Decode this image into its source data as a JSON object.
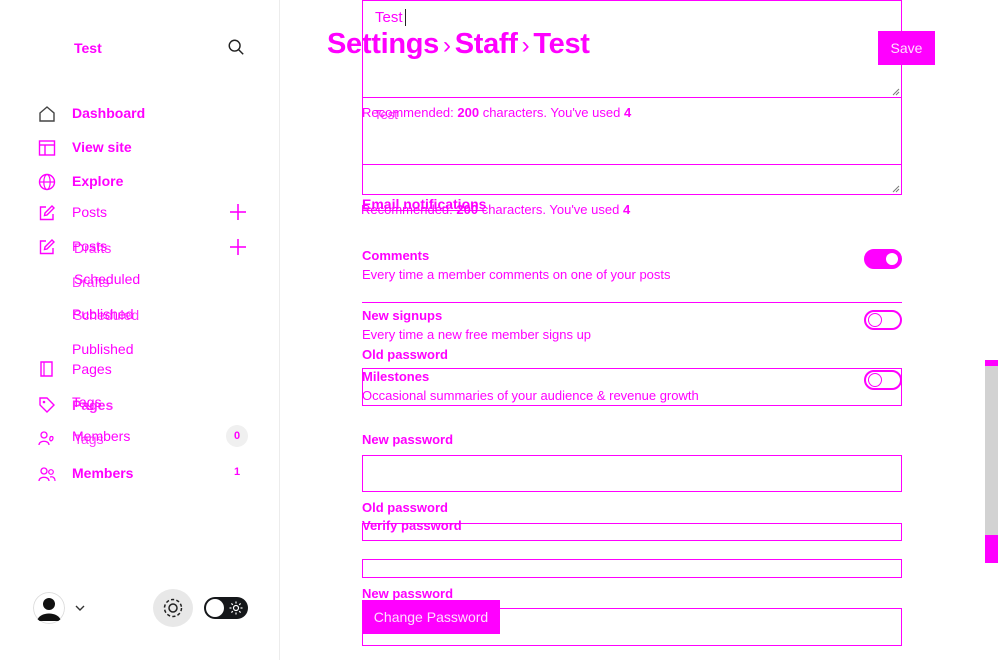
{
  "sidebar": {
    "site_name": "Test",
    "nav": {
      "dashboard": "Dashboard",
      "view_site": "View site",
      "explore": "Explore",
      "posts": "Posts",
      "drafts": "Drafts",
      "scheduled": "Scheduled",
      "published": "Published",
      "pages": "Pages",
      "tags": "Tags",
      "members": "Members"
    },
    "overlap": {
      "posts_shadow": "Posts",
      "drafts_shadow": "Drafts",
      "scheduled_shadow": "Scheduled",
      "published_shadow": "Published",
      "pages_shadow": "Pages",
      "members_shadow": "Members"
    },
    "counts": {
      "members_primary": "0",
      "members_secondary": "1"
    }
  },
  "header": {
    "crumb1": "Settings",
    "crumb2": "Staff",
    "crumb3": "Test",
    "separator": "›",
    "save_label": "Save"
  },
  "form": {
    "name_value": "Test",
    "bio_value": "Test",
    "recommended_prefix": "Recommended: ",
    "recommended_number": "200",
    "recommended_suffix": " characters. You've used ",
    "used_count": "4",
    "recommended_prefix_2": "Recommended: ",
    "recommended_number_2": "200",
    "recommended_suffix_2": " characters. You've used ",
    "used_count_2": "4",
    "email_notifications": "Email notifications",
    "comments_label": "Comments",
    "comments_desc": "Every time a member comments on one of your posts",
    "signups_label": "New signups",
    "signups_desc": "Every time a new free member signs up",
    "old_password_1": "Old password",
    "milestones_label": "Milestones",
    "milestones_desc": "Occasional summaries of your audience & revenue growth",
    "new_password_1": "New password",
    "old_password_2": "Old password",
    "verify_password": "Verify password",
    "new_password_2": "New password",
    "change_password": "Change Password",
    "toggles": {
      "comments": true,
      "signups": false,
      "milestones": false
    }
  },
  "colors": {
    "accent": "#ff00ff",
    "scrollbar": "#d2d2d2"
  }
}
